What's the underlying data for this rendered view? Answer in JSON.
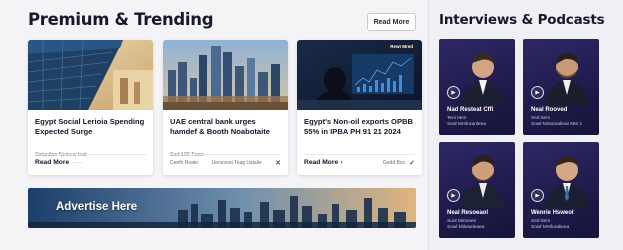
{
  "main": {
    "section_title": "Premium & Trending",
    "read_more_button": "Read More",
    "cards": [
      {
        "title": "Egypt Social Lerioia Spending Expected Surge",
        "meta": "Ozianitan Neinew leat",
        "read_more": "Read More",
        "sub": "·····",
        "icon": "more-icon"
      },
      {
        "title": "UAE central bank urges hamdef & Booth Noabotaite",
        "meta": "Sad 100 Twoo",
        "read_more": "Ceeth Roate",
        "sub": "Uenuvoot Teag Ustalie",
        "icon": "close-icon"
      },
      {
        "title": "Egypt's Non-oil exports OPBB 55% in IPBA PH 91 21 2024",
        "meta": "",
        "read_more": "Read More",
        "sub": "Gedd Boc",
        "icon": "check-icon"
      }
    ],
    "card_badge": "Rewt Mred",
    "ad_banner": "Advertise Here"
  },
  "sidebar": {
    "title": "Interviews & Podcasts",
    "items": [
      {
        "name": "Nad Resteat Cffi",
        "role": "Teni Item\nSeal Mrsfuranleea"
      },
      {
        "name": "Neal Rooved",
        "role": "Sed Item\nSowl Mntomalieat Mte 1"
      },
      {
        "name": "Neal Resoeaol",
        "role": "Suol Mimmes\nSowl Miluseleaea"
      },
      {
        "name": "Wenrie Hsweol",
        "role": "Sed Item\nSowl Mrsfuralieea"
      }
    ]
  },
  "colors": {
    "page_bg": "#f3f3f6",
    "title": "#16182c",
    "podcast_card": "#2b2660",
    "accent_white": "#ffffff"
  }
}
